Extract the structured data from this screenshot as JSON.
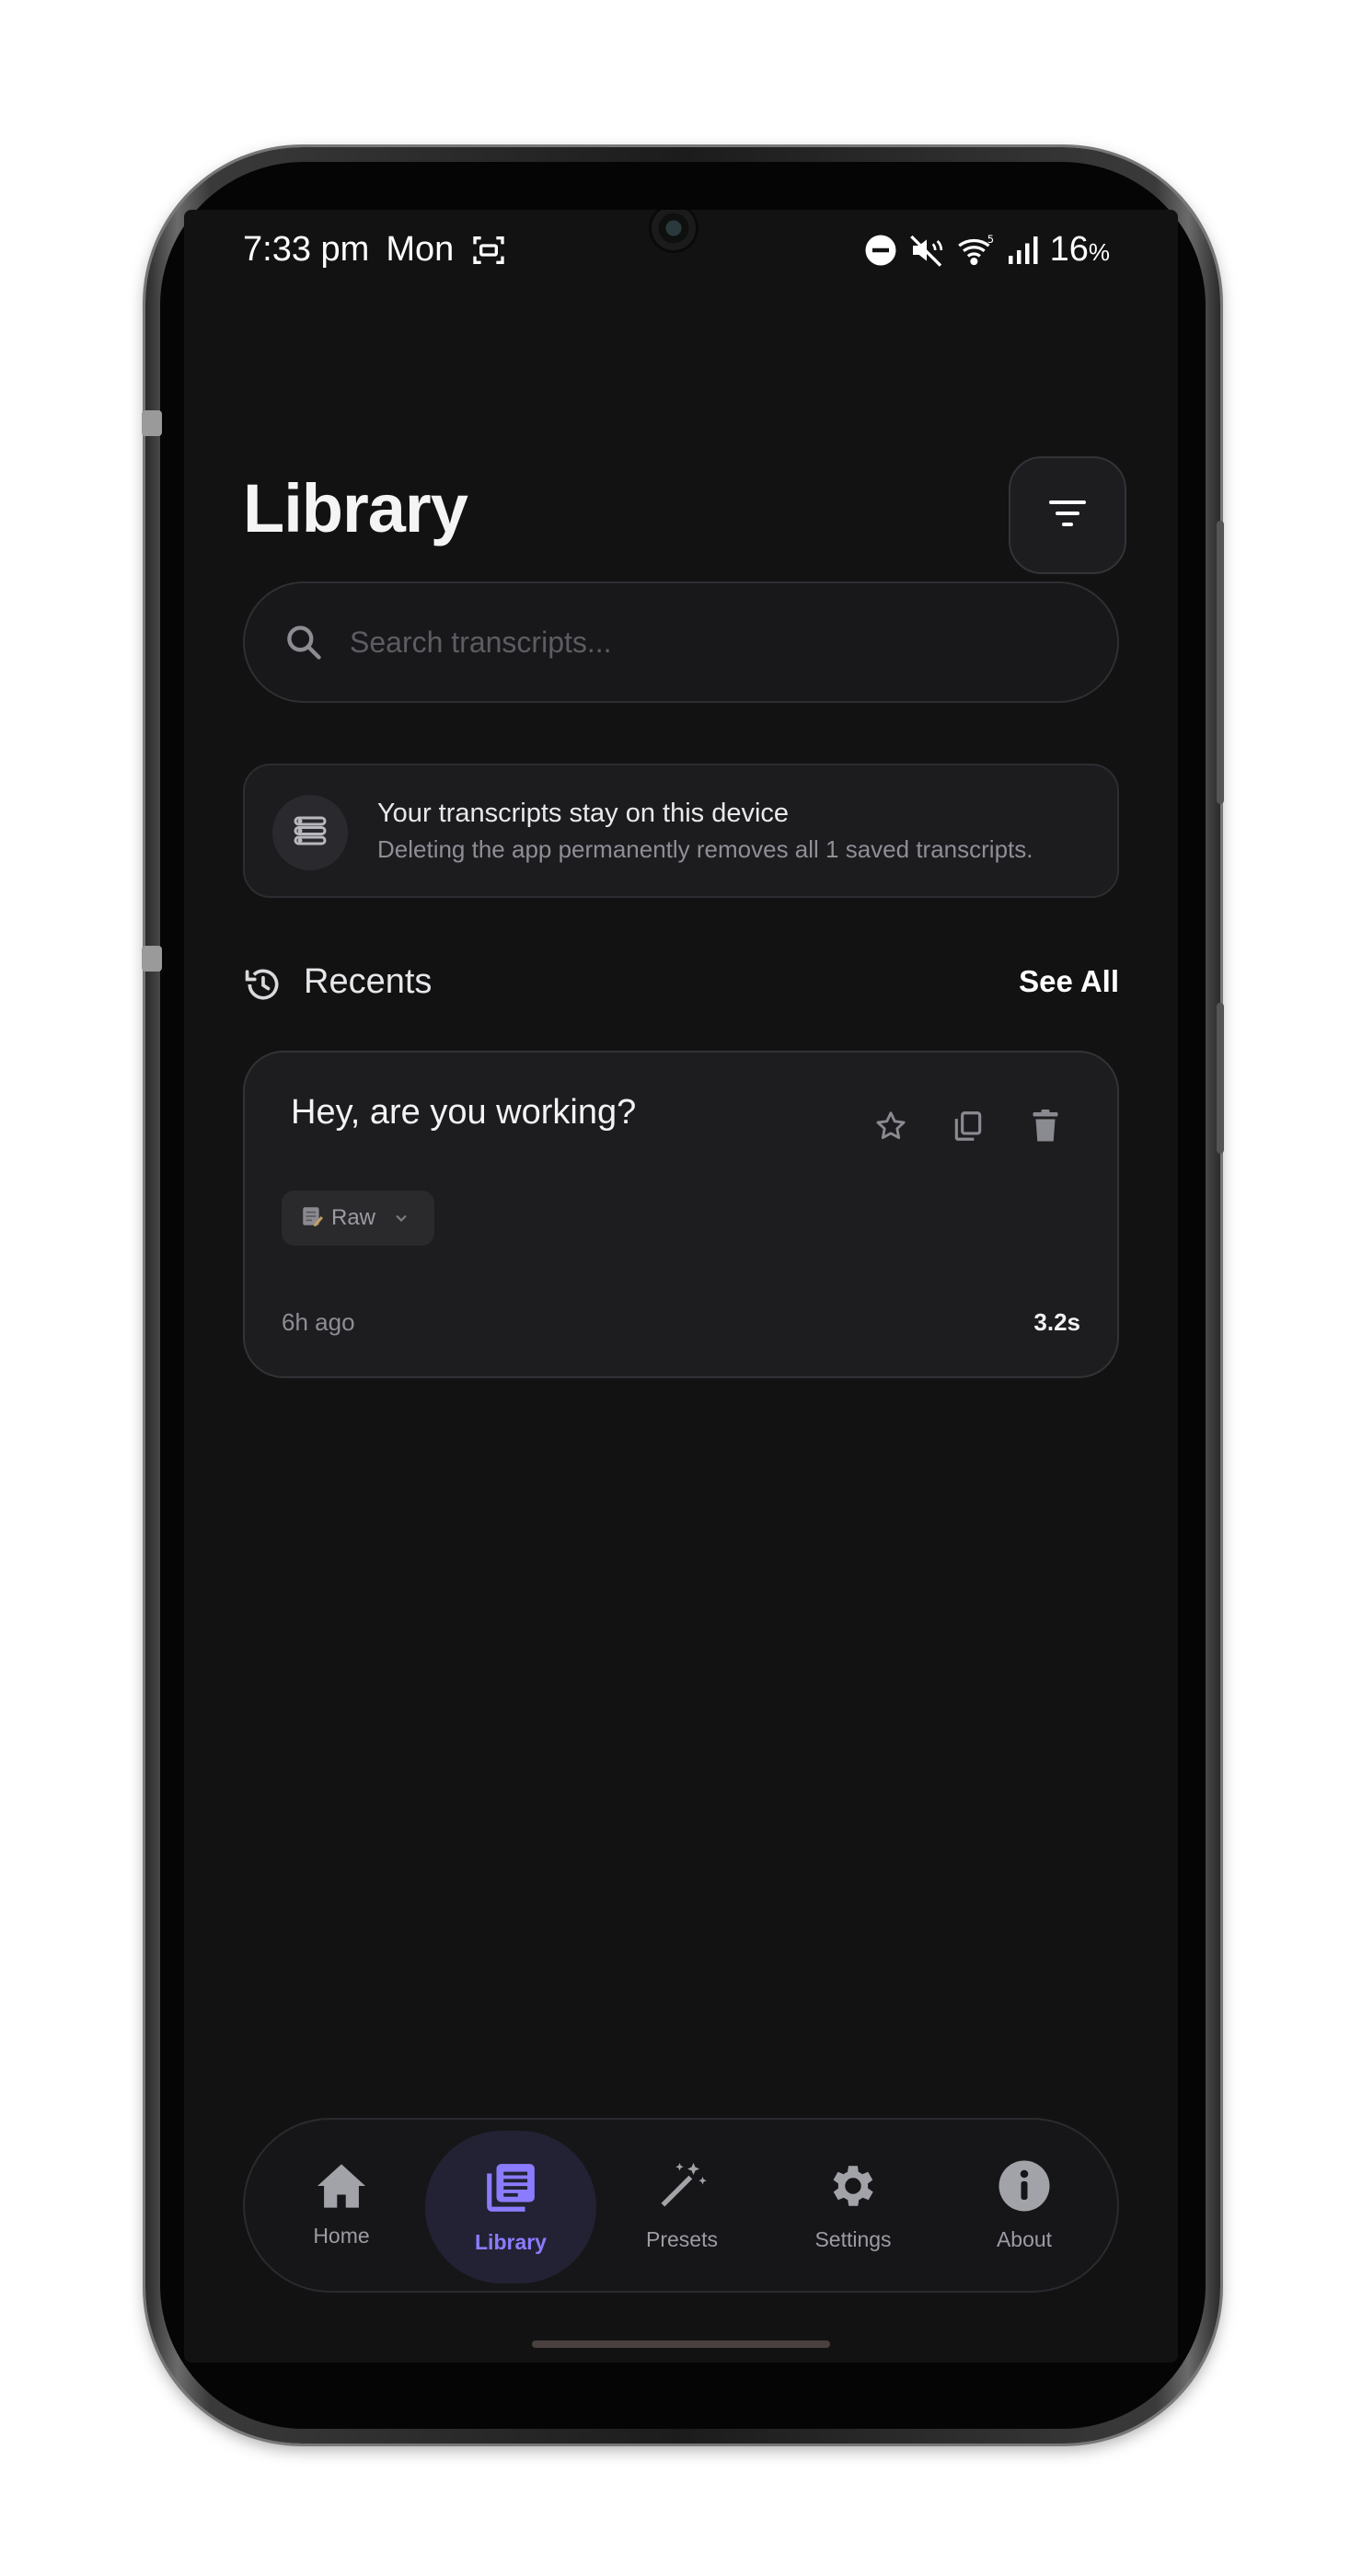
{
  "status_bar": {
    "time": "7:33 pm",
    "day": "Mon",
    "battery": "16",
    "battery_unit": "%"
  },
  "header": {
    "title": "Library"
  },
  "search": {
    "placeholder": "Search transcripts..."
  },
  "notice": {
    "title": "Your transcripts stay on this device",
    "subtitle": "Deleting the app permanently removes all 1 saved transcripts."
  },
  "recents": {
    "label": "Recents",
    "see_all": "See All",
    "items": [
      {
        "title": "Hey, are you working?",
        "mode": "Raw",
        "age": "6h ago",
        "duration": "3.2s"
      }
    ]
  },
  "nav": {
    "items": [
      {
        "label": "Home",
        "icon": "home-icon",
        "active": false
      },
      {
        "label": "Library",
        "icon": "library-icon",
        "active": true
      },
      {
        "label": "Presets",
        "icon": "magic-wand-icon",
        "active": false
      },
      {
        "label": "Settings",
        "icon": "gear-icon",
        "active": false
      },
      {
        "label": "About",
        "icon": "info-icon",
        "active": false
      }
    ]
  },
  "colors": {
    "background": "#121213",
    "accent": "#8b7cff",
    "card": "#1d1d20"
  }
}
